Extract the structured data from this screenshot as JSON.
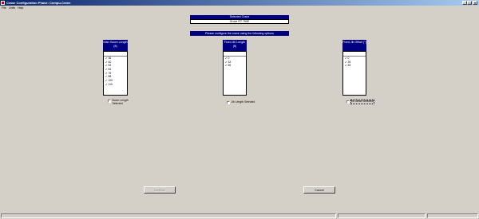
{
  "window": {
    "title": "Crane Configuration Phase: Compu-Crane",
    "minimize": "_",
    "maximize": "□",
    "close": "×"
  },
  "menu": [
    "File",
    "Units",
    "Help"
  ],
  "selected_crane": {
    "label": "Selected Crane",
    "value": "Grove RT 750E"
  },
  "instruction": "Please configure the crane using the following options",
  "main_boom": {
    "header": "Main Boom Length (ft)",
    "items": [
      "36",
      "40",
      "52",
      "64",
      "76",
      "88",
      "100",
      "110"
    ],
    "checkbox_label": "Boom Length Selected"
  },
  "fixed_jib": {
    "header": "Fixed Jib Length (ft)",
    "items": [
      "0",
      "33",
      "56"
    ],
    "checkbox_label": "Jib Length Selected"
  },
  "fixed_jib_offset": {
    "header": "Fixed Jib Offset (°)",
    "items": [
      "0",
      "25",
      "45"
    ],
    "checkbox_label": "Jib Offset Selected"
  },
  "buttons": {
    "continue": "Continue",
    "cancel": "Cancel"
  },
  "colors": {
    "face": "#d4d0c8",
    "header_navy": "#000080",
    "title_gradient_start": "#0a246a"
  }
}
